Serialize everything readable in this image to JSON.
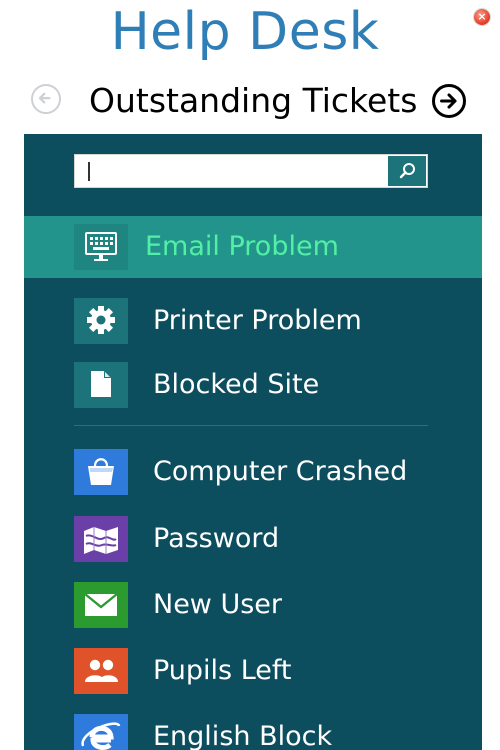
{
  "app": {
    "title": "Help Desk"
  },
  "header": {
    "section_title": "Outstanding Tickets"
  },
  "search": {
    "value": "",
    "placeholder": ""
  },
  "items_group_1": [
    {
      "label": "Email Problem",
      "icon": "keyboard-monitor-icon",
      "selected": true
    },
    {
      "label": "Printer Problem",
      "icon": "gear-icon",
      "selected": false
    },
    {
      "label": "Blocked Site",
      "icon": "document-icon",
      "selected": false
    }
  ],
  "items_group_2": [
    {
      "label": "Computer Crashed",
      "icon": "shopping-bag-icon"
    },
    {
      "label": "Password",
      "icon": "map-icon"
    },
    {
      "label": "New User",
      "icon": "mail-icon"
    },
    {
      "label": "Pupils Left",
      "icon": "people-icon"
    },
    {
      "label": "English Block",
      "icon": "internet-explorer-icon"
    }
  ],
  "colors": {
    "title": "#2f7fb6",
    "panel_bg": "#0c4d5e",
    "selected_bg": "#23948b",
    "selected_text": "#52f0a5",
    "tile_teal": "#1c7379",
    "tile_blue": "#2f7bdc",
    "tile_purple": "#6b3fa8",
    "tile_green": "#2b9a2f",
    "tile_orange": "#e0532a"
  }
}
